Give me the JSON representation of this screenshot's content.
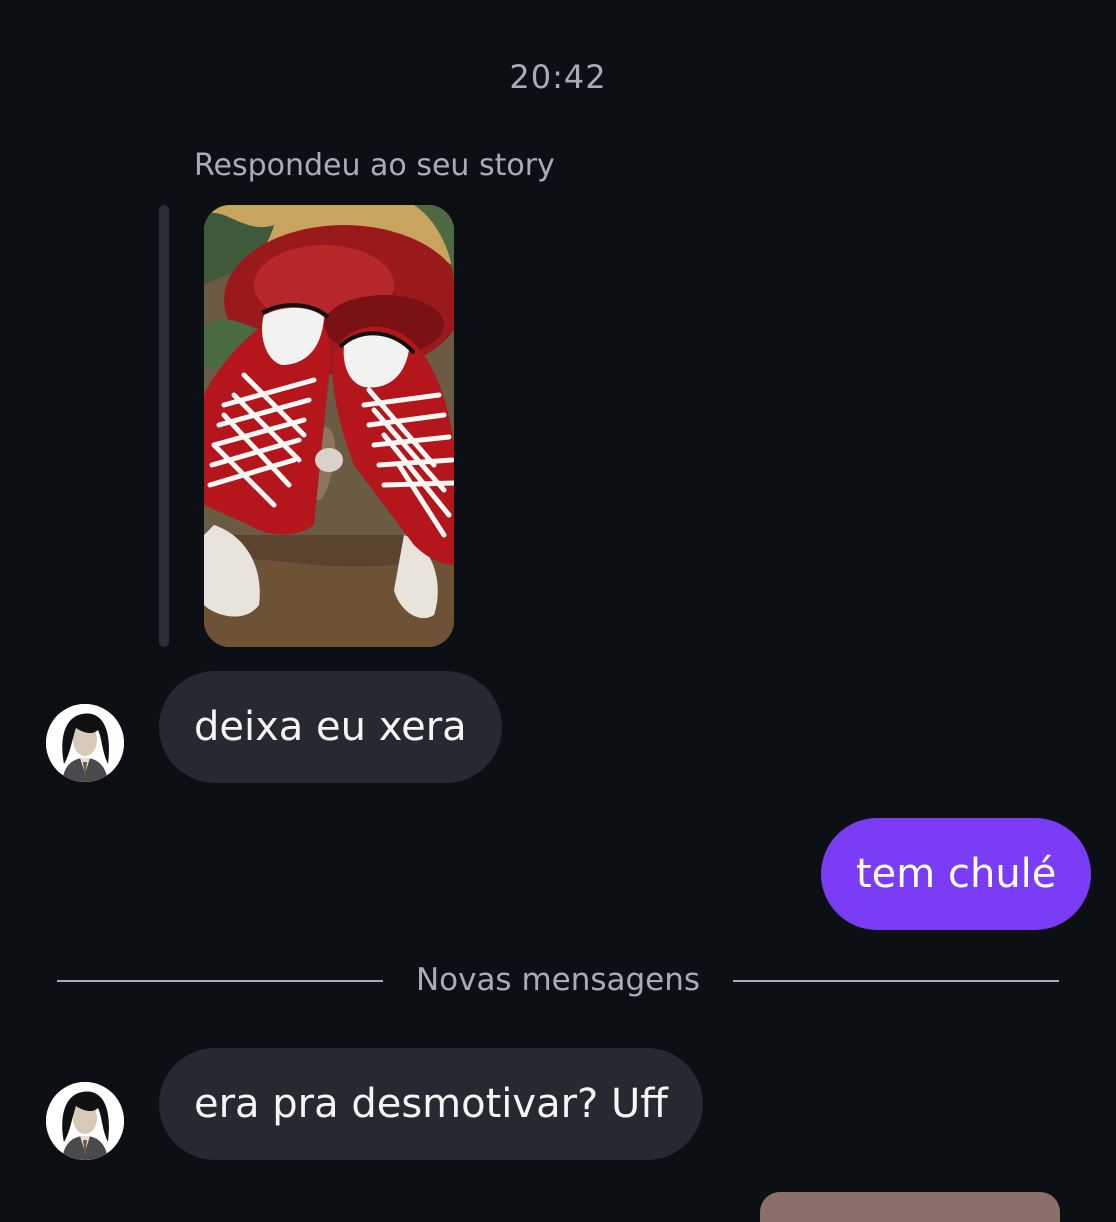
{
  "thread": {
    "timestamp": "20:42",
    "story_reply_label": "Respondeu ao seu story",
    "new_messages_label": "Novas mensagens"
  },
  "messages": [
    {
      "direction": "incoming",
      "text": "deixa eu xera"
    },
    {
      "direction": "outgoing",
      "text": "tem chulé"
    },
    {
      "direction": "incoming",
      "text": "era pra desmotivar? Uff"
    }
  ],
  "colors": {
    "background": "#0c1014",
    "incoming_bubble": "#262a30",
    "outgoing_bubble": "#7a3cf4",
    "muted_text": "#a8adb5"
  }
}
